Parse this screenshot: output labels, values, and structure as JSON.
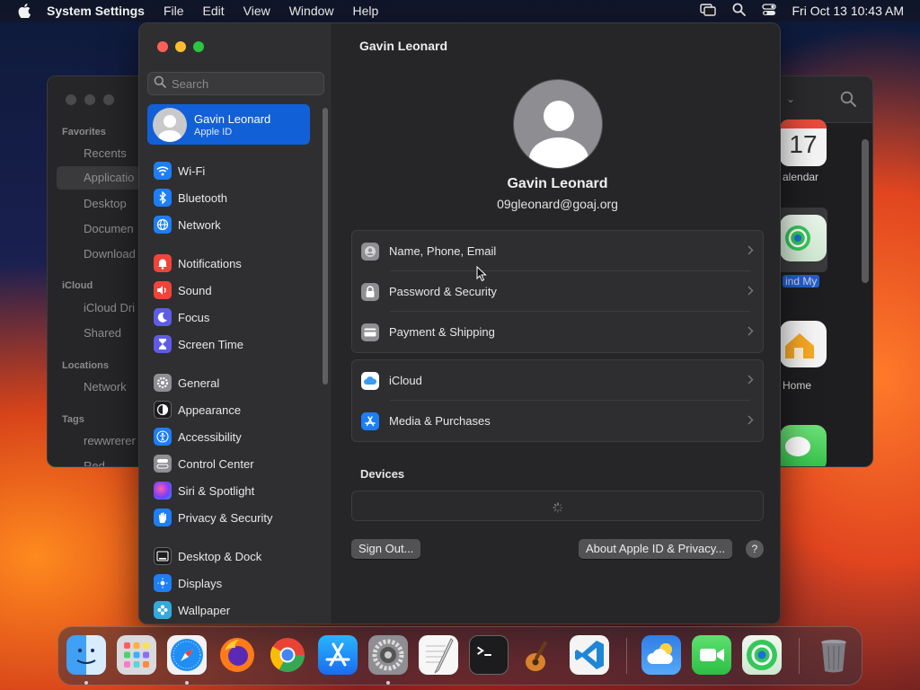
{
  "menubar": {
    "app_name": "System Settings",
    "menus": [
      "File",
      "Edit",
      "View",
      "Window",
      "Help"
    ],
    "clock": "Fri Oct 13  10:43 AM"
  },
  "finder": {
    "sections": {
      "favorites": "Favorites",
      "icloud": "iCloud",
      "locations": "Locations",
      "tags": "Tags"
    },
    "items": {
      "recents": "Recents",
      "applications": "Applicatio",
      "desktop": "Desktop",
      "documents": "Documen",
      "downloads": "Download",
      "icloud_drive": "iCloud Dri",
      "shared": "Shared",
      "network": "Network",
      "tag1": "rewwrerer",
      "tag2": "Red"
    },
    "apps": {
      "calendar_day": "17",
      "calendar": "alendar",
      "findmy": "ind My",
      "home": "Home"
    }
  },
  "settings": {
    "search_placeholder": "Search",
    "account": {
      "name": "Gavin Leonard",
      "subtitle": "Apple ID"
    },
    "sidebar": [
      {
        "label": "Wi-Fi",
        "icon": "wifi-icon",
        "color": "#1e7ef5"
      },
      {
        "label": "Bluetooth",
        "icon": "bluetooth-icon",
        "color": "#1e7ef5"
      },
      {
        "label": "Network",
        "icon": "network-icon",
        "color": "#1e7ef5"
      },
      {
        "label": "Notifications",
        "icon": "bell-icon",
        "color": "#f0443a"
      },
      {
        "label": "Sound",
        "icon": "speaker-icon",
        "color": "#f0443a"
      },
      {
        "label": "Focus",
        "icon": "moon-icon",
        "color": "#5e5ce6"
      },
      {
        "label": "Screen Time",
        "icon": "hourglass-icon",
        "color": "#5e5ce6"
      },
      {
        "label": "General",
        "icon": "gear-icon",
        "color": "#8e8e93"
      },
      {
        "label": "Appearance",
        "icon": "appearance-icon",
        "color": "#1c1c1e"
      },
      {
        "label": "Accessibility",
        "icon": "accessibility-icon",
        "color": "#1e7ef5"
      },
      {
        "label": "Control Center",
        "icon": "control-center-icon",
        "color": "#8e8e93"
      },
      {
        "label": "Siri & Spotlight",
        "icon": "siri-icon",
        "color": "#b03bd8"
      },
      {
        "label": "Privacy & Security",
        "icon": "hand-icon",
        "color": "#1e7ef5"
      },
      {
        "label": "Desktop & Dock",
        "icon": "dock-icon",
        "color": "#1c1c1e"
      },
      {
        "label": "Displays",
        "icon": "display-icon",
        "color": "#1e7ef5"
      },
      {
        "label": "Wallpaper",
        "icon": "wallpaper-icon",
        "color": "#34aadc"
      }
    ],
    "main": {
      "title": "Gavin Leonard",
      "profile_name": "Gavin Leonard",
      "profile_email": "09gleonard@goaj.org",
      "group1": [
        {
          "label": "Name, Phone, Email",
          "icon": "contact-card-icon"
        },
        {
          "label": "Password & Security",
          "icon": "lock-icon"
        },
        {
          "label": "Payment & Shipping",
          "icon": "credit-card-icon"
        }
      ],
      "group2": [
        {
          "label": "iCloud",
          "icon": "icloud-icon"
        },
        {
          "label": "Media & Purchases",
          "icon": "app-store-icon"
        }
      ],
      "devices_title": "Devices",
      "sign_out": "Sign Out...",
      "about": "About Apple ID & Privacy...",
      "help": "?"
    }
  },
  "dock": [
    "finder-icon",
    "launchpad-icon",
    "safari-icon",
    "firefox-icon",
    "chrome-icon",
    "app-store-icon",
    "system-settings-icon",
    "textedit-icon",
    "terminal-icon",
    "garageband-icon",
    "vscode-icon",
    "weather-icon",
    "facetime-icon",
    "findmy-icon",
    "trash-icon"
  ]
}
